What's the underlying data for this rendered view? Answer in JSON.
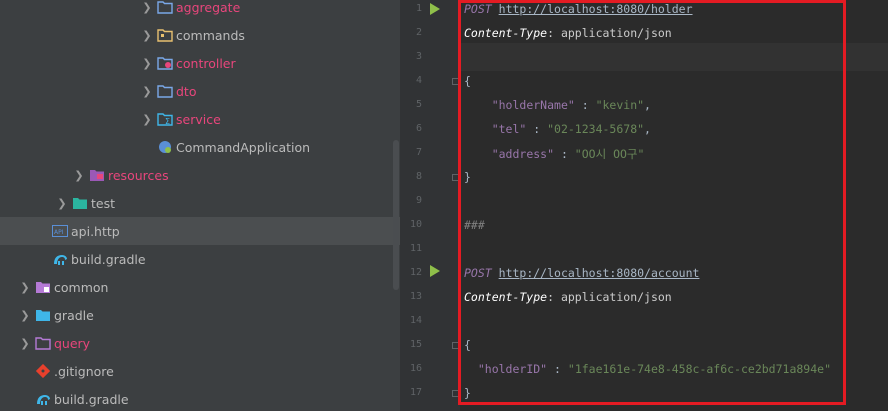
{
  "tree": {
    "items": [
      {
        "label": "aggregate",
        "color": "pink",
        "icon": "folder-icon"
      },
      {
        "label": "commands",
        "color": "plain",
        "icon": "folder-icon"
      },
      {
        "label": "controller",
        "color": "pink",
        "icon": "folder-gear-icon"
      },
      {
        "label": "dto",
        "color": "pink",
        "icon": "folder-icon"
      },
      {
        "label": "service",
        "color": "pink",
        "icon": "folder-sigma-icon"
      },
      {
        "label": "CommandApplication",
        "color": "plain",
        "icon": "spring-class-icon"
      },
      {
        "label": "resources",
        "color": "pink",
        "icon": "resources-folder-icon"
      },
      {
        "label": "test",
        "color": "plain",
        "icon": "test-folder-icon"
      },
      {
        "label": "api.http",
        "color": "plain",
        "icon": "api-file-icon"
      },
      {
        "label": "build.gradle",
        "color": "plain",
        "icon": "gradle-elephant-icon"
      },
      {
        "label": "common",
        "color": "plain",
        "icon": "module-folder-icon"
      },
      {
        "label": "gradle",
        "color": "plain",
        "icon": "gradle-folder-icon"
      },
      {
        "label": "query",
        "color": "pink",
        "icon": "module-folder-icon"
      },
      {
        "label": ".gitignore",
        "color": "plain",
        "icon": "git-icon"
      },
      {
        "label": "build.gradle",
        "color": "plain",
        "icon": "gradle-elephant-icon"
      }
    ]
  },
  "editor": {
    "line_numbers": [
      "1",
      "2",
      "3",
      "4",
      "5",
      "6",
      "7",
      "8",
      "9",
      "10",
      "11",
      "12",
      "13",
      "14",
      "15",
      "16",
      "17"
    ],
    "request1": {
      "method": "POST",
      "url": "http://localhost:8080/holder",
      "header_name": "Content-Type",
      "header_value": "application/json",
      "brace_open": "{",
      "k1": "\"holderName\"",
      "v1": "\"kevin\"",
      "k2": "\"tel\"",
      "v2": "\"02-1234-5678\"",
      "k3": "\"address\"",
      "v3": "\"OO시 OO구\"",
      "brace_close": "}"
    },
    "separator": "###",
    "request2": {
      "method": "POST",
      "url": "http://localhost:8080/account",
      "header_name": "Content-Type",
      "header_value": "application/json",
      "brace_open": "{",
      "k1": "\"holderID\"",
      "v1": "\"1fae161e-74e8-458c-af6c-ce2bd71a894e\"",
      "brace_close": "}"
    }
  },
  "colors": {
    "accent_red": "#e41b23",
    "pink": "#e8467c",
    "run_green": "#8fbf4a"
  }
}
